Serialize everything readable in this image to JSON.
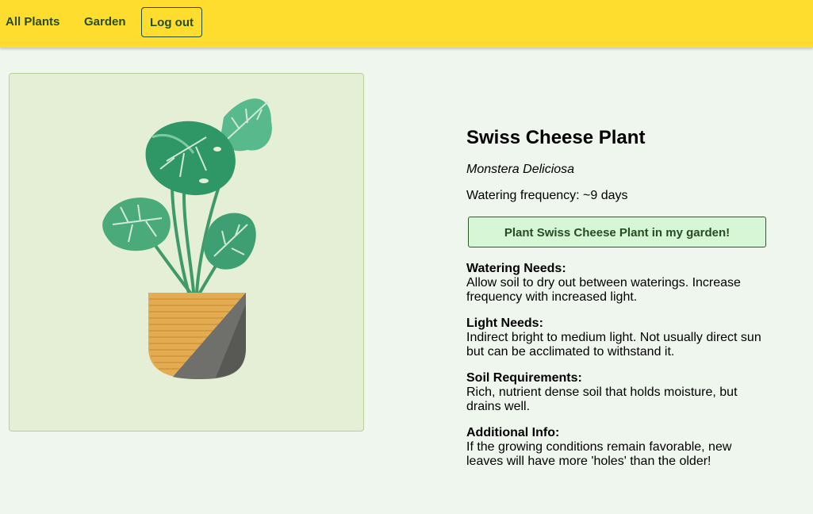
{
  "nav": {
    "all_plants": "All Plants",
    "garden": "Garden",
    "logout": "Log out"
  },
  "plant": {
    "name": "Swiss Cheese Plant",
    "scientific_name": "Monstera Deliciosa",
    "watering_frequency": "Watering frequency: ~9 days",
    "plant_button": "Plant Swiss Cheese Plant in my garden!",
    "info": [
      {
        "title": "Watering Needs:",
        "text": "Allow soil to dry out between waterings. Increase frequency with increased light."
      },
      {
        "title": "Light Needs:",
        "text": "Indirect bright to medium light. Not usually direct sun but can be acclimated to withstand it."
      },
      {
        "title": "Soil Requirements:",
        "text": "Rich, nutrient dense soil that holds moisture, but drains well."
      },
      {
        "title": "Additional Info:",
        "text": "If the growing conditions remain favorable, new leaves will have more 'holes' than the older!"
      }
    ]
  },
  "colors": {
    "topbar": "#fedd2e",
    "nav_text": "#264d22",
    "page_bg": "#eff6ee",
    "image_bg": "#e4efd6",
    "button_bg": "#d6f6d6"
  },
  "icons": {
    "plant_image": "monstera-plant-illustration"
  }
}
